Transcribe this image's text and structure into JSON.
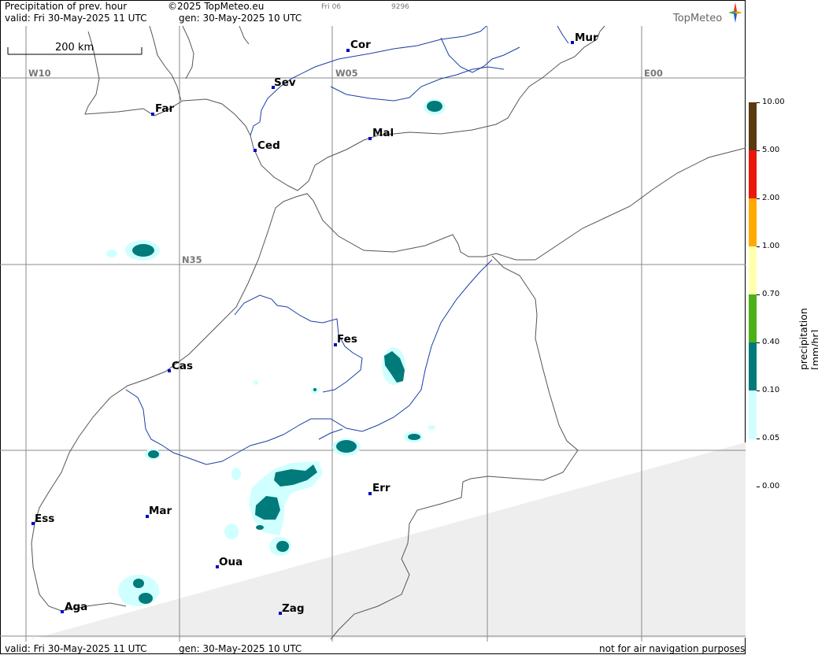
{
  "header": {
    "title": "Precipitation of prev. hour",
    "copyright": "©2025 TopMeteo.eu",
    "day_code": "Fri 06",
    "number": "9296",
    "valid": "valid:  Fri  30-May-2025  11 UTC",
    "gen": "gen: 30-May-2025 10 UTC",
    "logo": "TopMeteo"
  },
  "footer": {
    "valid": "valid:  Fri  30-May-2025  11 UTC",
    "gen": "gen: 30-May-2025 10 UTC",
    "note": "not for air navigation purposes"
  },
  "scale_bar": "200 km",
  "grid_labels": [
    "W10",
    "W05",
    "E00",
    "N35"
  ],
  "cities": [
    "Cor",
    "Mur",
    "Sev",
    "Far",
    "Mal",
    "Ced",
    "Fes",
    "Cas",
    "Err",
    "Mar",
    "Ess",
    "Oua",
    "Zag",
    "Aga"
  ],
  "legend": {
    "unit": "precipitation  [mm/hr]",
    "values": [
      "10.00",
      "5.00",
      "2.00",
      "1.00",
      "0.70",
      "0.40",
      "0.10",
      "0.05",
      "0.00"
    ],
    "colors": [
      "#5a3a10",
      "#e8180c",
      "#ffaa00",
      "#ffffb0",
      "#4cb018",
      "#007a7a",
      "#d0ffff"
    ]
  },
  "colors": {
    "light_precip": "#d0ffff",
    "teal_precip": "#007a7a",
    "coast": "#555555",
    "river": "#1a3fa8",
    "no_data": "#eeeeee"
  }
}
